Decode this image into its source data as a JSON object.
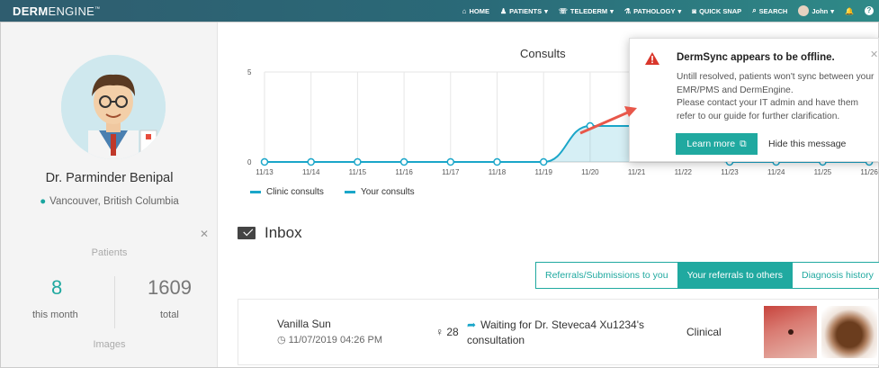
{
  "brand": {
    "bold": "DERM",
    "light": "ENGINE",
    "tm": "™"
  },
  "nav": {
    "home": "HOME",
    "patients": "PATIENTS",
    "telederm": "TELEDERM",
    "pathology": "PATHOLOGY",
    "quick_snap": "QUICK SNAP",
    "search": "SEARCH",
    "user": "John"
  },
  "profile": {
    "name": "Dr. Parminder Benipal",
    "location": "Vancouver, British Columbia",
    "patients_heading": "Patients",
    "this_month_value": "8",
    "this_month_label": "this month",
    "total_value": "1609",
    "total_label": "total",
    "images_heading": "Images"
  },
  "chart_data": {
    "type": "area",
    "title": "Consults",
    "categories": [
      "11/13",
      "11/14",
      "11/15",
      "11/16",
      "11/17",
      "11/18",
      "11/19",
      "11/20",
      "11/21",
      "11/22",
      "11/23",
      "11/24",
      "11/25",
      "11/26"
    ],
    "series": [
      {
        "name": "Clinic consults",
        "values": [
          0,
          0,
          0,
          0,
          0,
          0,
          0,
          2,
          2,
          2,
          0,
          0,
          0,
          0
        ]
      },
      {
        "name": "Your consults",
        "values": [
          0,
          0,
          0,
          0,
          0,
          0,
          0,
          2,
          2,
          2,
          0,
          0,
          0,
          0
        ]
      }
    ],
    "ylim": [
      0,
      5
    ],
    "yticks": [
      "0",
      "5"
    ],
    "grid": true,
    "legend": "bottom-left",
    "color": "#1aa6c9"
  },
  "inbox": {
    "title": "Inbox",
    "tabs": [
      "Referrals/Submissions to you",
      "Your referrals to others",
      "Diagnosis history"
    ],
    "active_tab": 1,
    "row": {
      "name": "Vanilla Sun",
      "time": "11/07/2019 04:26 PM",
      "age": "28",
      "status": "Waiting for Dr. Steveca4 Xu1234's consultation",
      "type": "Clinical"
    }
  },
  "popup": {
    "title": "DermSync appears to be offline.",
    "body_1": "Untill resolved, patients won't sync between your EMR/PMS and DermEngine.",
    "body_2": "Please contact your IT admin and have them refer to our guide for further clarification.",
    "learn_more": "Learn more",
    "hide": "Hide this message"
  },
  "colors": {
    "accent": "#20a9a0",
    "line": "#1aa6c9",
    "warn": "#d9362b"
  }
}
